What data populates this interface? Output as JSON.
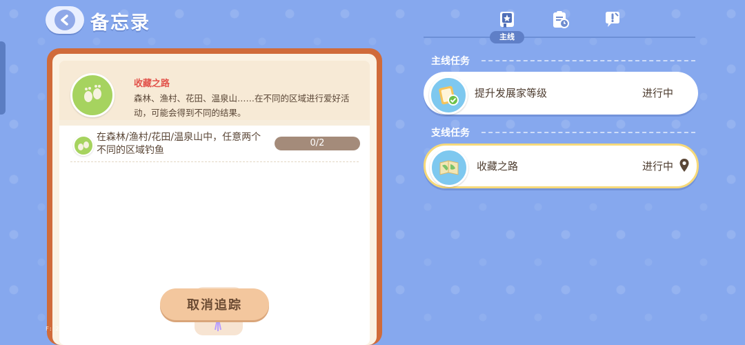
{
  "header": {
    "title": "备忘录"
  },
  "tabs": [
    {
      "icon": "star-book-icon",
      "label": "主线",
      "active": true
    },
    {
      "icon": "clipboard-clock-icon",
      "active": false
    },
    {
      "icon": "speech-check-icon",
      "active": false
    }
  ],
  "quest_detail": {
    "title": "收藏之路",
    "description": "森林、渔村、花田、温泉山……在不同的区域进行爱好活动，可能会得到不同的结果。",
    "task": {
      "text": "在森林/渔村/花田/温泉山中，任意两个不同的区域钓鱼",
      "progress": "0/2",
      "progress_fraction": 0
    },
    "reward_icon": "balloon-bouquet-icon",
    "cancel_label": "取消追踪"
  },
  "debug": {
    "f1": "F: 21",
    "f2": "R: 24",
    "id": "ID: 8hk4a8b"
  },
  "main_section": {
    "title": "主线任务",
    "items": [
      {
        "name": "提升发展家等级",
        "status": "进行中",
        "icon": "clipboard-check-icon"
      }
    ]
  },
  "side_section": {
    "title": "支线任务",
    "items": [
      {
        "name": "收藏之路",
        "status": "进行中",
        "icon": "map-book-icon",
        "selected": true
      }
    ]
  },
  "colors": {
    "background": "#86a8ee",
    "panel_border": "#d06b3a",
    "quest_title": "#e2524a",
    "selected_border": "#f6d97a"
  }
}
